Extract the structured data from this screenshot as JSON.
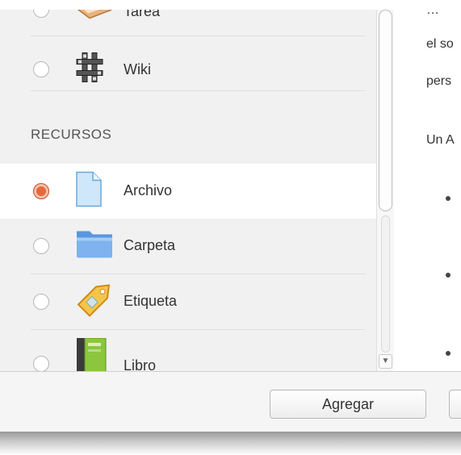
{
  "activities": [
    {
      "label": "Tarea",
      "icon": "assignment-icon"
    },
    {
      "label": "Wiki",
      "icon": "wiki-icon"
    }
  ],
  "resources_header": "RECURSOS",
  "resources": [
    {
      "label": "Archivo",
      "icon": "file-icon",
      "selected": true
    },
    {
      "label": "Carpeta",
      "icon": "folder-icon",
      "selected": false
    },
    {
      "label": "Etiqueta",
      "icon": "label-tag-icon",
      "selected": false
    },
    {
      "label": "Libro",
      "icon": "book-icon",
      "selected": false
    }
  ],
  "description": {
    "lines": [
      "el so",
      "pers",
      "Un A"
    ]
  },
  "footer": {
    "add_label": "Agregar"
  },
  "colors": {
    "selected_radio": "#e46a3e",
    "panel_bg": "#f1f1f1"
  }
}
